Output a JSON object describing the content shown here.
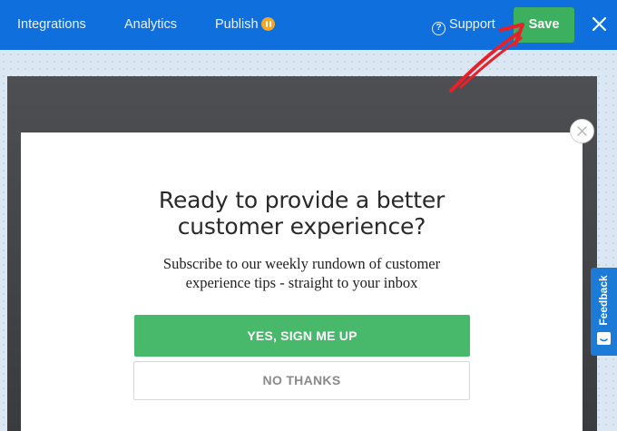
{
  "topbar": {
    "nav": [
      "Integrations",
      "Analytics",
      "Publish"
    ],
    "publish_badge_icon": "pause-icon",
    "support_label": "Support",
    "support_icon": "question-circle-icon",
    "save_label": "Save",
    "close_icon": "close-icon",
    "colors": {
      "bar": "#0f6fdc",
      "save": "#3cb05e",
      "badge": "#f6a623"
    }
  },
  "popup": {
    "headline_line1": "Ready to provide a better",
    "headline_line2": "customer experience?",
    "subtext_line1": "Subscribe to our weekly rundown of customer",
    "subtext_line2": "experience tips - straight to your inbox",
    "yes_label": "YES, SIGN ME UP",
    "no_label": "NO THANKS",
    "close_icon": "close-icon",
    "colors": {
      "yes": "#48b86b"
    }
  },
  "feedback": {
    "label": "Feedback",
    "icon": "chat-icon"
  },
  "annotation": {
    "arrow_color": "#e8202a"
  }
}
